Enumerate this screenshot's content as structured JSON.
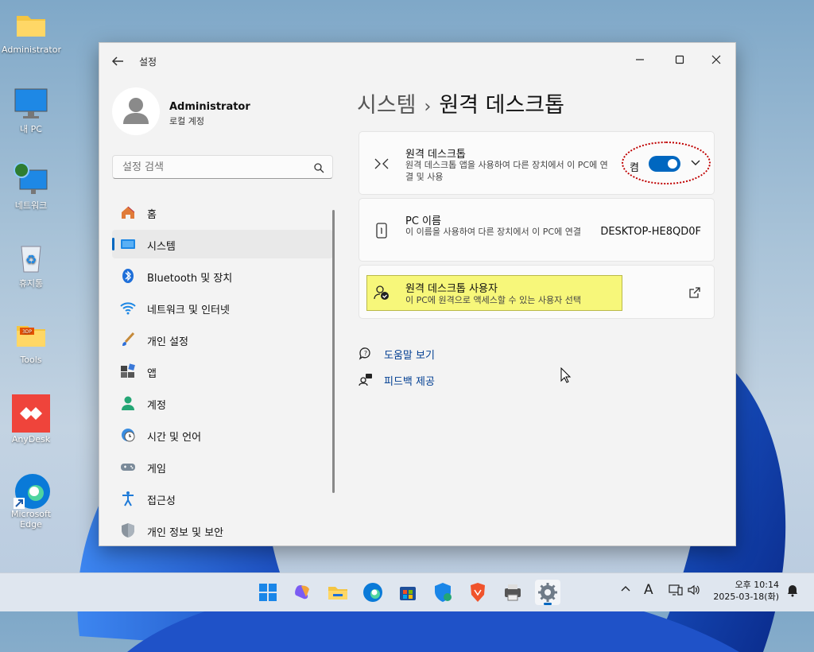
{
  "desktop": {
    "icons": [
      {
        "label": "Administrator",
        "icon": "folder-icon"
      },
      {
        "label": "내 PC",
        "icon": "monitor-icon"
      },
      {
        "label": "네트워크",
        "icon": "network-icon"
      },
      {
        "label": "휴지통",
        "icon": "recycle-bin-icon"
      },
      {
        "label": "Tools",
        "icon": "tools-folder-icon"
      },
      {
        "label": "AnyDesk",
        "icon": "anydesk-icon"
      },
      {
        "label": "Microsoft Edge",
        "icon": "edge-icon"
      }
    ]
  },
  "window": {
    "title": "설정",
    "back_icon": "back-arrow-icon",
    "controls": {
      "minimize": "—",
      "maximize": "☐",
      "close": "✕"
    }
  },
  "profile": {
    "name": "Administrator",
    "subtitle": "로컬 계정"
  },
  "search": {
    "placeholder": "설정 검색"
  },
  "nav": {
    "items": [
      {
        "label": "홈",
        "icon": "home-icon"
      },
      {
        "label": "시스템",
        "icon": "system-icon",
        "active": true
      },
      {
        "label": "Bluetooth 및 장치",
        "icon": "bluetooth-icon"
      },
      {
        "label": "네트워크 및 인터넷",
        "icon": "wifi-icon"
      },
      {
        "label": "개인 설정",
        "icon": "brush-icon"
      },
      {
        "label": "앱",
        "icon": "apps-icon"
      },
      {
        "label": "계정",
        "icon": "account-icon"
      },
      {
        "label": "시간 및 언어",
        "icon": "clock-globe-icon"
      },
      {
        "label": "게임",
        "icon": "gamepad-icon"
      },
      {
        "label": "접근성",
        "icon": "accessibility-icon"
      },
      {
        "label": "개인 정보 및 보안",
        "icon": "shield-icon"
      }
    ]
  },
  "breadcrumb": {
    "parent": "시스템",
    "separator": "›",
    "current": "원격 데스크톱"
  },
  "remote_desktop": {
    "title": "원격 데스크톱",
    "description": "원격 데스크톱 앱을 사용하여 다른 장치에서 이 PC에 연결 및 사용",
    "toggle_label": "켬",
    "toggle_on": true
  },
  "pc_name": {
    "title": "PC 이름",
    "description": "이 이름을 사용하여 다른 장치에서 이 PC에 연결",
    "value": "DESKTOP-HE8QD0F"
  },
  "rd_users": {
    "title": "원격 데스크톱 사용자",
    "description": "이 PC에 원격으로 액세스할 수 있는 사용자 선택"
  },
  "links": {
    "help": "도움말 보기",
    "feedback": "피드백 제공"
  },
  "taskbar": {
    "apps": [
      "start-icon",
      "copilot-icon",
      "file-explorer-icon",
      "edge-icon",
      "store-icon",
      "defender-icon",
      "brave-icon",
      "printer-icon",
      "settings-icon"
    ],
    "tray": {
      "chevron": "^",
      "ime": "A"
    },
    "time": "오후 10:14",
    "date": "2025-03-18(화)"
  },
  "colors": {
    "accent": "#0067c0",
    "highlight": "#f7f77a",
    "annotation": "#c00000"
  }
}
